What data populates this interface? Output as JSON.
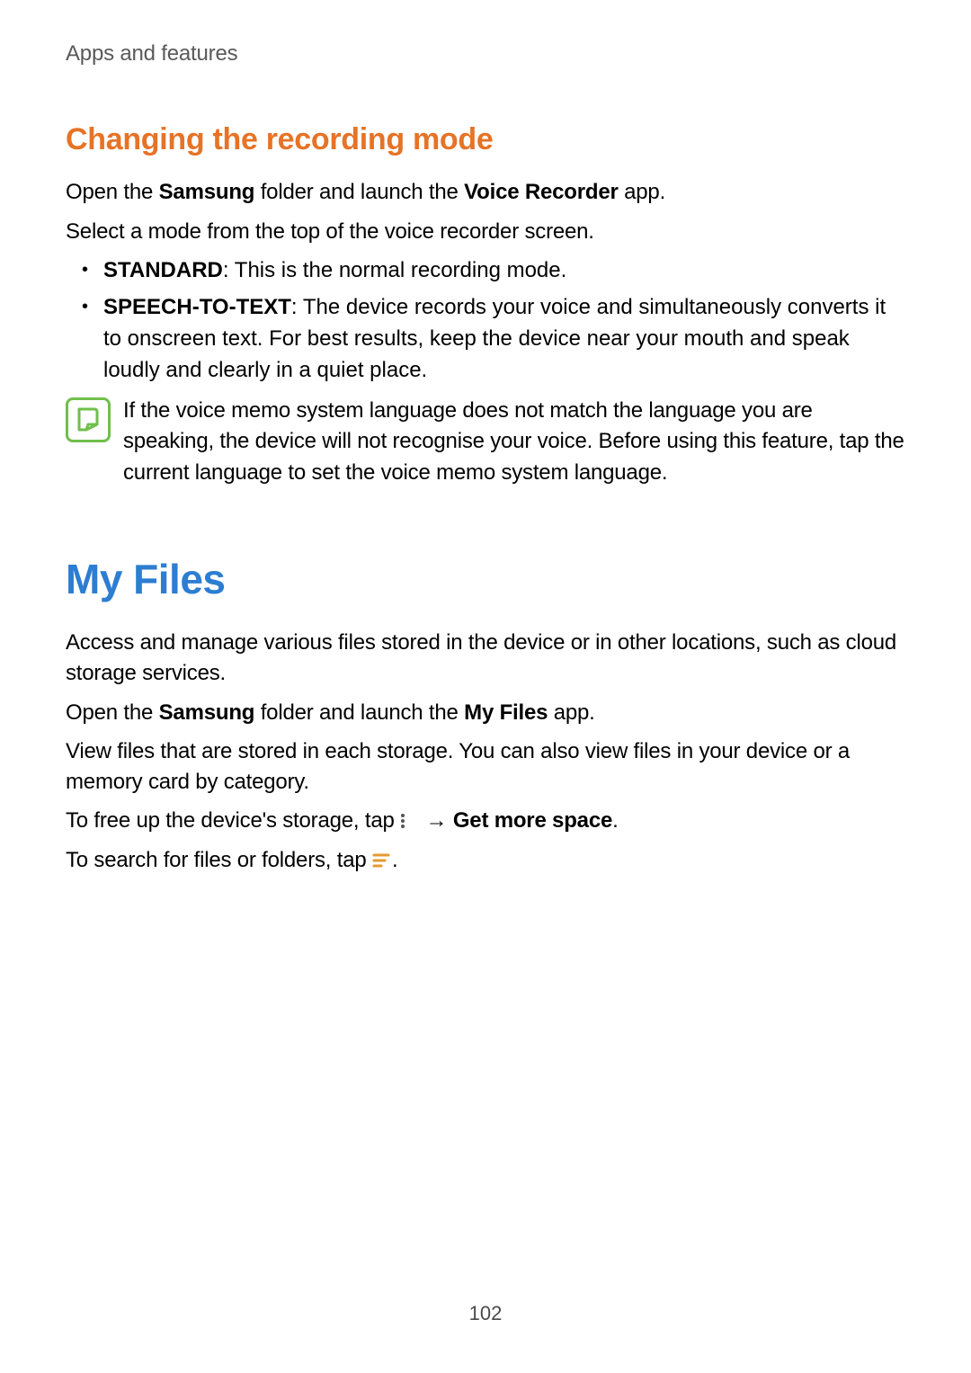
{
  "breadcrumb": "Apps and features",
  "section1": {
    "heading": "Changing the recording mode",
    "p1_parts": [
      "Open the ",
      "Samsung",
      " folder and launch the ",
      "Voice Recorder",
      " app."
    ],
    "p2": "Select a mode from the top of the voice recorder screen.",
    "bullets": [
      {
        "bold": "STANDARD",
        "rest": ": This is the normal recording mode."
      },
      {
        "bold": "SPEECH-TO-TEXT",
        "rest": ": The device records your voice and simultaneously converts it to onscreen text. For best results, keep the device near your mouth and speak loudly and clearly in a quiet place."
      }
    ],
    "note": "If the voice memo system language does not match the language you are speaking, the device will not recognise your voice. Before using this feature, tap the current language to set the voice memo system language."
  },
  "section2": {
    "heading": "My Files",
    "p1": "Access and manage various files stored in the device or in other locations, such as cloud storage services.",
    "p2_parts": [
      "Open the ",
      "Samsung",
      " folder and launch the ",
      "My Files",
      " app."
    ],
    "p3": "View files that are stored in each storage. You can also view files in your device or a memory card by category.",
    "p4_parts": [
      "To free up the device's storage, tap ",
      " → ",
      "Get more space",
      "."
    ],
    "p5_parts": [
      "To search for files or folders, tap ",
      "."
    ]
  },
  "page_number": "102"
}
